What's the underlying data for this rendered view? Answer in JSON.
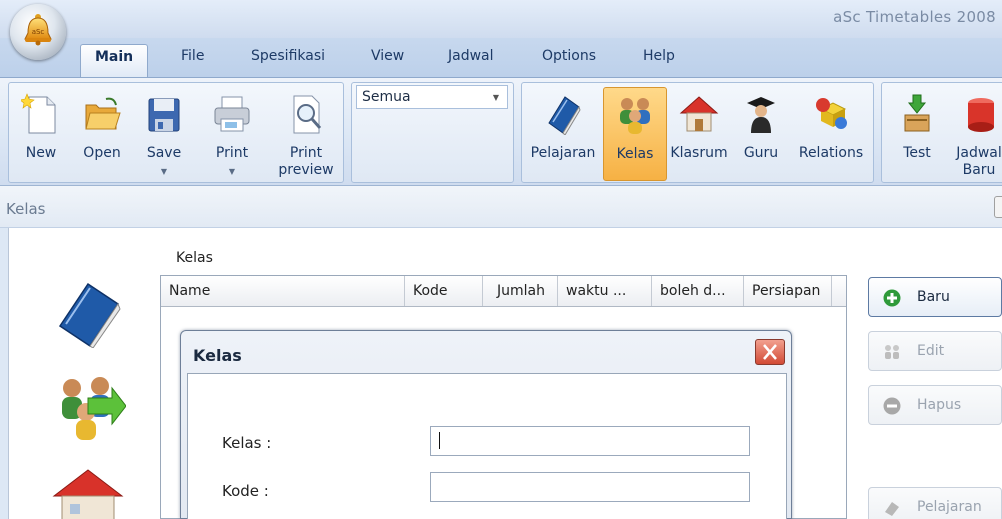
{
  "app": {
    "title": "aSc Timetables 2008",
    "orb_text": "aSc"
  },
  "tabs": [
    {
      "label": "Main",
      "active": true
    },
    {
      "label": "File"
    },
    {
      "label": "Spesifikasi"
    },
    {
      "label": "View"
    },
    {
      "label": "Jadwal"
    },
    {
      "label": "Options"
    },
    {
      "label": "Help"
    }
  ],
  "ribbon": {
    "file_group": {
      "new": "New",
      "open": "Open",
      "save": "Save",
      "print": "Print",
      "print_preview_1": "Print",
      "print_preview_2": "preview"
    },
    "filter_dropdown": {
      "value": "Semua"
    },
    "data_group": {
      "pelajaran": "Pelajaran",
      "kelas": "Kelas",
      "klasrum": "Klasrum",
      "guru": "Guru",
      "relations": "Relations"
    },
    "test_group": {
      "test": "Test",
      "jadwal_baru_1": "Jadwal",
      "jadwal_baru_2": "Baru"
    }
  },
  "panel": {
    "title": "Kelas"
  },
  "grid": {
    "label": "Kelas",
    "columns": [
      "Name",
      "Kode",
      "Jumlah",
      "waktu ...",
      "boleh d...",
      "Persiapan"
    ]
  },
  "dialog": {
    "title": "Kelas",
    "fields": [
      {
        "label": "Kelas :",
        "value": ""
      },
      {
        "label": "Kode :",
        "value": ""
      }
    ]
  },
  "side_buttons": [
    {
      "label": "Baru",
      "enabled": true
    },
    {
      "label": "Edit",
      "enabled": false
    },
    {
      "label": "Hapus",
      "enabled": false
    },
    {
      "label": "Pelajaran",
      "enabled": false
    }
  ],
  "colors": {
    "accent_selected": "#f6b144",
    "ribbon_bg": "#dce7f5",
    "close_red": "#d24a35"
  }
}
